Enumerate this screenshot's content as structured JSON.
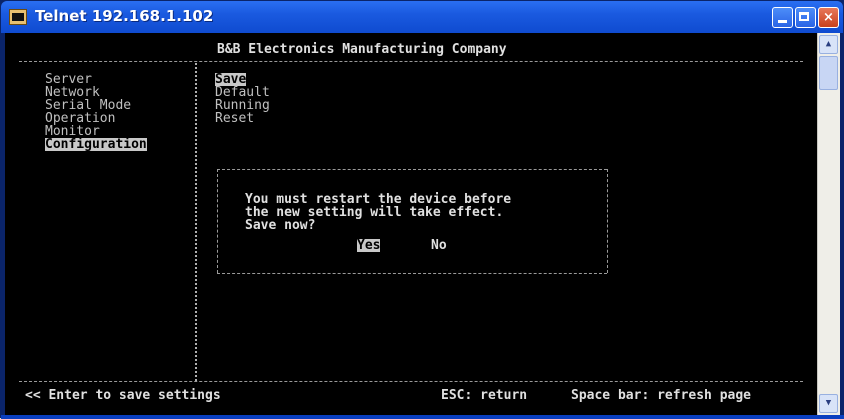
{
  "window": {
    "title": "Telnet 192.168.1.102",
    "minimize_label": "",
    "maximize_label": "",
    "close_label": "×"
  },
  "header": {
    "company": "B&B Electronics Manufacturing Company"
  },
  "menu": {
    "items": [
      {
        "label": "Server"
      },
      {
        "label": "Network"
      },
      {
        "label": "Serial Mode"
      },
      {
        "label": "Operation"
      },
      {
        "label": "Monitor"
      },
      {
        "label": "Configuration",
        "selected": true
      }
    ]
  },
  "submenu": {
    "items": [
      {
        "label": "Save",
        "selected": true
      },
      {
        "label": "Default"
      },
      {
        "label": "Running"
      },
      {
        "label": "Reset"
      }
    ]
  },
  "dialog": {
    "line1": "You must restart the device before",
    "line2": "the new setting will take effect.",
    "line3": "Save now?",
    "yes_label": "Yes",
    "no_label": "No"
  },
  "footer": {
    "left": "<< Enter to save settings",
    "esc": "ESC: return",
    "space": "Space bar: refresh page"
  },
  "icons": {
    "app": "telnet-console-icon",
    "scroll_up": "arrow-up-icon",
    "scroll_down": "arrow-down-icon"
  },
  "colors": {
    "titlebar": "#1a5ae0",
    "console_bg": "#000000",
    "console_text": "#c0c0c0",
    "highlight_bg": "#c8c8c8"
  }
}
